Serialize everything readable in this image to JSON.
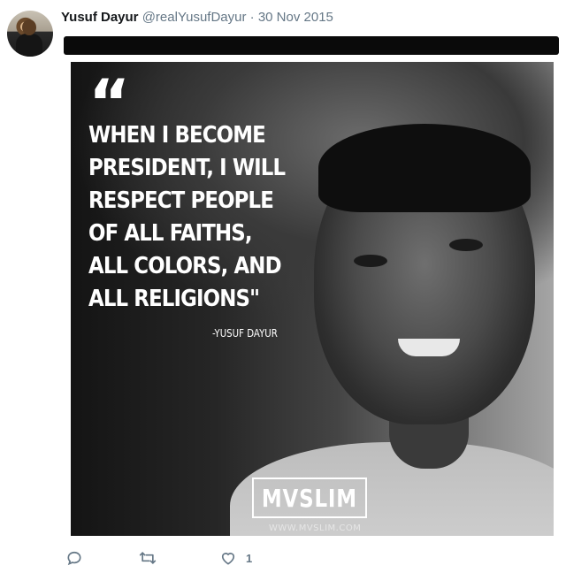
{
  "tweet": {
    "author_name": "Yusuf Dayur",
    "handle": "@realYusufDayur",
    "separator": "·",
    "date": "30 Nov 2015"
  },
  "image": {
    "quote_mark": "“",
    "quote_lines": [
      "WHEN I BECOME",
      "PRESIDENT, I WILL",
      "RESPECT PEOPLE",
      "OF ALL FAITHS,",
      "ALL COLORS, AND",
      "ALL RELIGIONS\""
    ],
    "attribution": "-YUSUF DAYUR",
    "logo_text": "MVSLIM",
    "logo_url": "WWW.MVSLIM.COM"
  },
  "actions": {
    "reply_icon": "reply-icon",
    "retweet_icon": "retweet-icon",
    "like_icon": "heart-icon",
    "like_count": "1"
  },
  "colors": {
    "text_primary": "#14171a",
    "text_secondary": "#657786",
    "top_bar": "#0a0a0a"
  }
}
